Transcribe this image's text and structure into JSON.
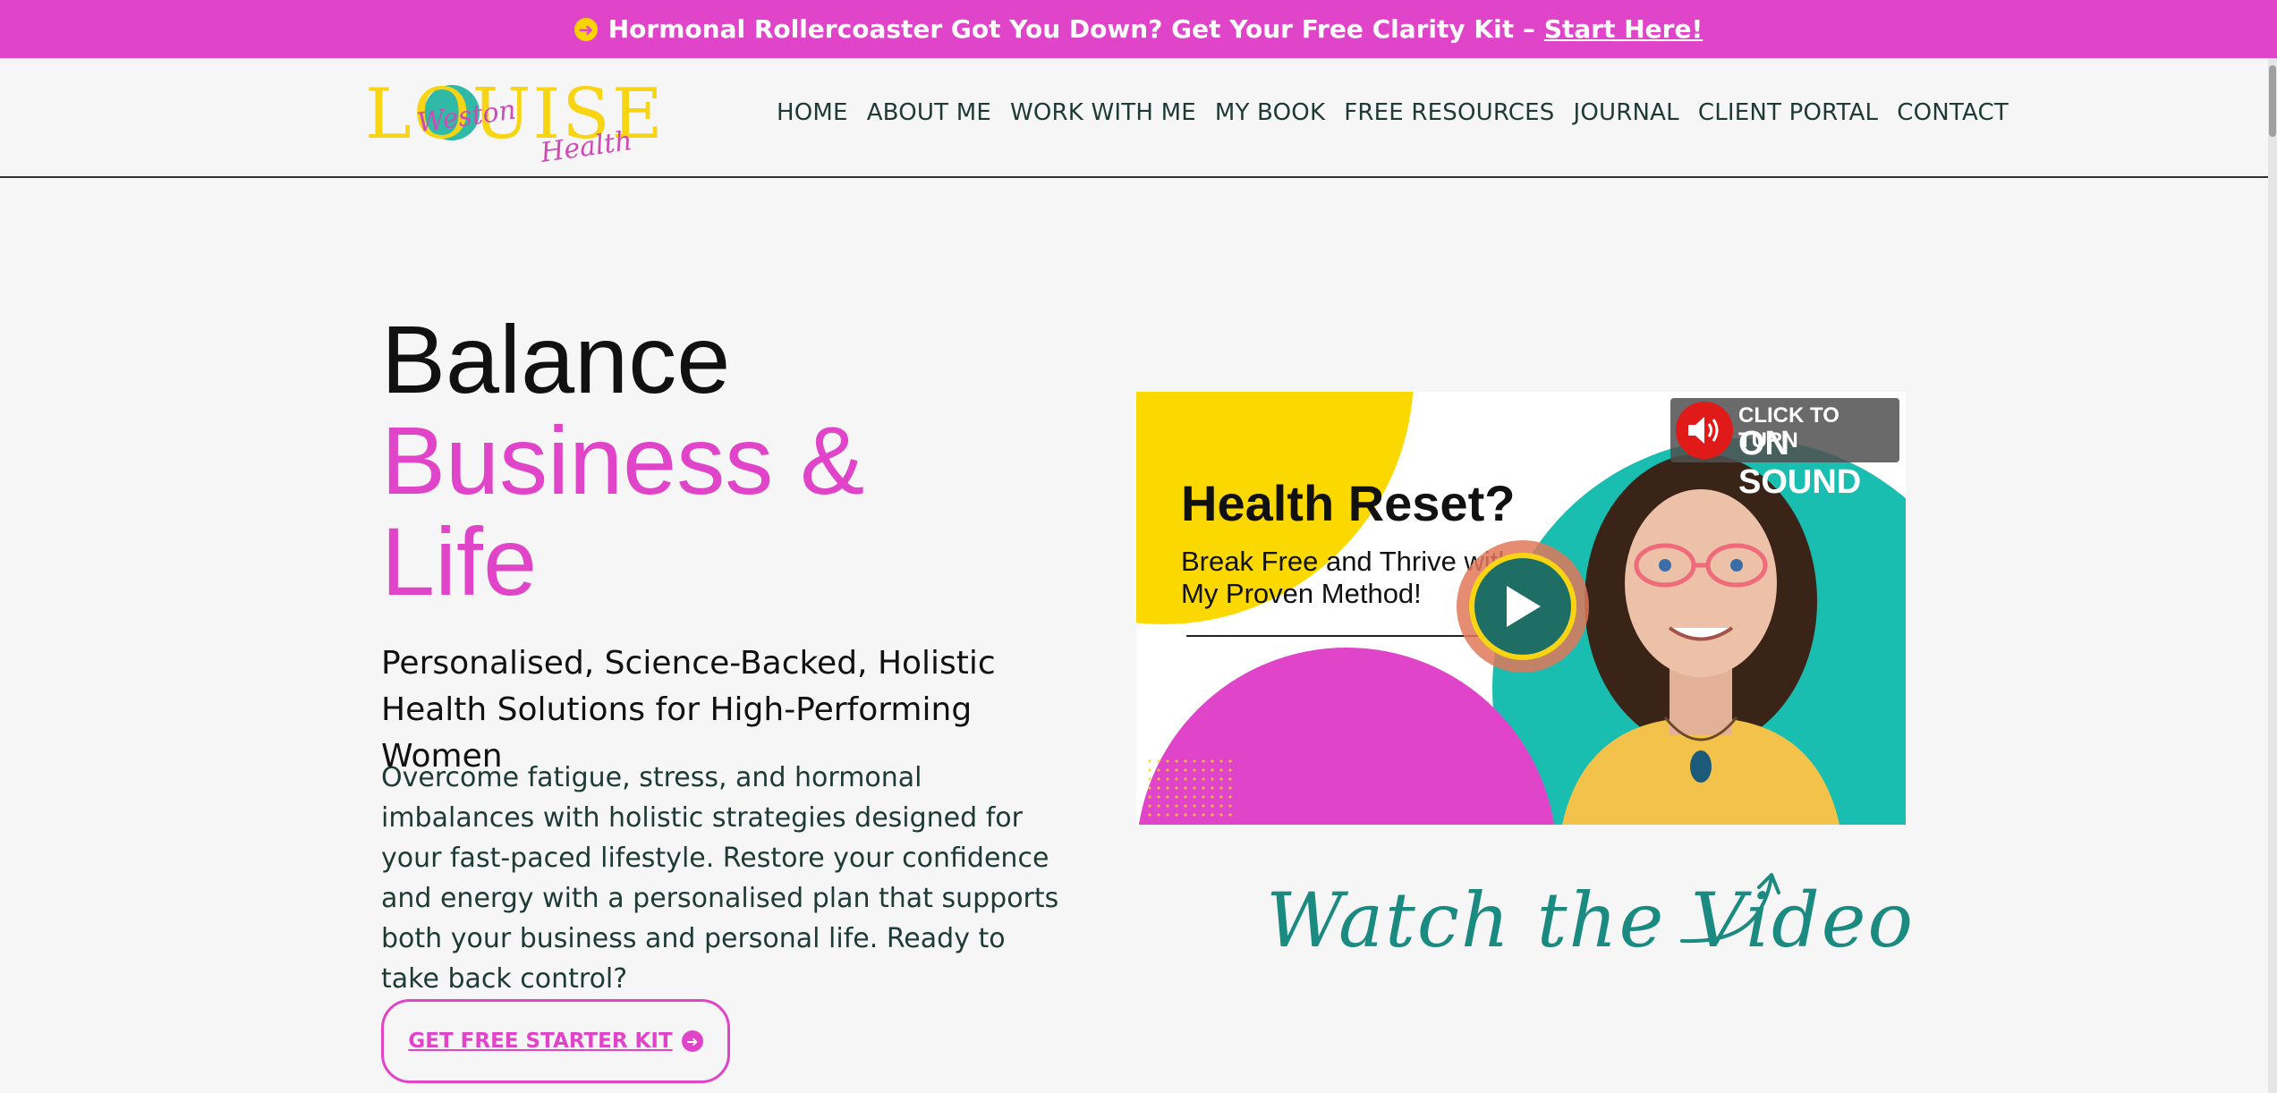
{
  "banner": {
    "text": "Hormonal Rollercoaster Got You Down? Get Your Free Clarity Kit –",
    "link": "Start Here!"
  },
  "logo": {
    "main": "LOUISE",
    "script_top": "Weston",
    "script_bottom": "Health"
  },
  "nav": {
    "items": [
      "HOME",
      "ABOUT ME",
      "WORK WITH ME",
      "MY BOOK",
      "FREE RESOURCES",
      "JOURNAL",
      "CLIENT PORTAL",
      "CONTACT"
    ]
  },
  "hero": {
    "line1": "Balance",
    "line2": "Business &",
    "line3": "Life",
    "subtitle": "Personalised, Science-Backed, Holistic Health Solutions for High-Performing Women",
    "body": "Overcome fatigue, stress, and hormonal imbalances with holistic strategies designed for your fast-paced lifestyle. Restore your confidence and energy with a personalised plan that supports both your business and personal life. Ready to take back control?",
    "cta": "GET FREE STARTER KIT"
  },
  "video": {
    "title": "Health Reset?",
    "subtitle": "Break Free and Thrive with My Proven Method!",
    "sound_line1": "CLICK TO TURN",
    "sound_line2": "ON SOUND"
  },
  "watch_label": "Watch the Video",
  "colors": {
    "magenta": "#e044c9",
    "yellow": "#fbd900",
    "teal": "#19beb0",
    "dark_green": "#1e3a34"
  },
  "icons": [
    "arrow-circle-icon",
    "play-icon",
    "speaker-icon",
    "curved-arrow-icon"
  ]
}
